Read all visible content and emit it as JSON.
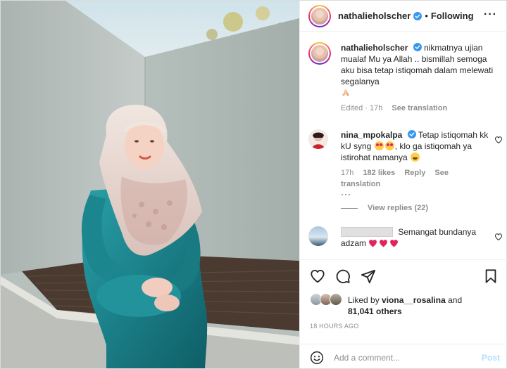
{
  "post": {
    "author": "nathalieholscher",
    "following_label": "Following",
    "more_label": "···"
  },
  "caption": {
    "username": "nathalieholscher",
    "text": "nikmatnya ujian mualaf Mu ya Allah .. bismillah semoga aku bisa tetap istiqomah dalam melewati segalanya",
    "edited": "Edited · 17h",
    "see_translation": "See translation"
  },
  "comments": [
    {
      "username": "nina_mpokalpa",
      "text_a": "Tetap istiqomah kk kU syng",
      "text_b": ", klo ga istiqomah ya istirohat namanya",
      "time": "17h",
      "likes": "182 likes",
      "reply": "Reply",
      "see_translation": "See translation",
      "more": "···",
      "view_replies": "View replies (22)"
    },
    {
      "username": "",
      "text": "Semangat bundanya adzam"
    }
  ],
  "likes": {
    "prefix": "Liked by",
    "liked_user": "viona__rosalina",
    "joiner": "and",
    "others": "81,041 others"
  },
  "timestamp": "18 HOURS AGO",
  "add_comment": {
    "placeholder": "Add a comment...",
    "post_label": "Post"
  },
  "colors": {
    "verified": "#3897f0",
    "post_disabled": "#b2dffc",
    "heart_red": "#ed4956",
    "muted": "#8e8e8e"
  },
  "icons": [
    "verified-icon",
    "heart-icon",
    "comment-icon",
    "share-icon",
    "bookmark-icon",
    "emoji-icon"
  ]
}
